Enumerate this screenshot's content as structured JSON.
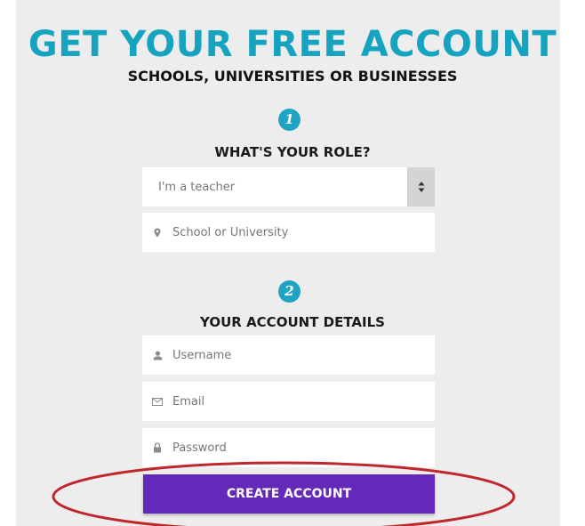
{
  "header": {
    "title": "GET YOUR FREE ACCOUNT",
    "subtitle": "SCHOOLS, UNIVERSITIES OR BUSINESSES"
  },
  "step1": {
    "number": "1",
    "label": "WHAT'S YOUR ROLE?",
    "role_select": {
      "selected": "I'm a teacher"
    },
    "school_field": {
      "placeholder": "School or University",
      "icon": "map-pin-icon"
    }
  },
  "step2": {
    "number": "2",
    "label": "YOUR ACCOUNT DETAILS",
    "username_field": {
      "placeholder": "Username",
      "icon": "user-icon"
    },
    "email_field": {
      "placeholder": "Email",
      "icon": "envelope-icon"
    },
    "password_field": {
      "placeholder": "Password",
      "icon": "lock-icon"
    }
  },
  "actions": {
    "create_account_label": "CREATE ACCOUNT"
  },
  "colors": {
    "title": "#16a3c0",
    "step_badge": "#1fa4c4",
    "button": "#6429b8",
    "highlight_ellipse": "#c0272d"
  }
}
